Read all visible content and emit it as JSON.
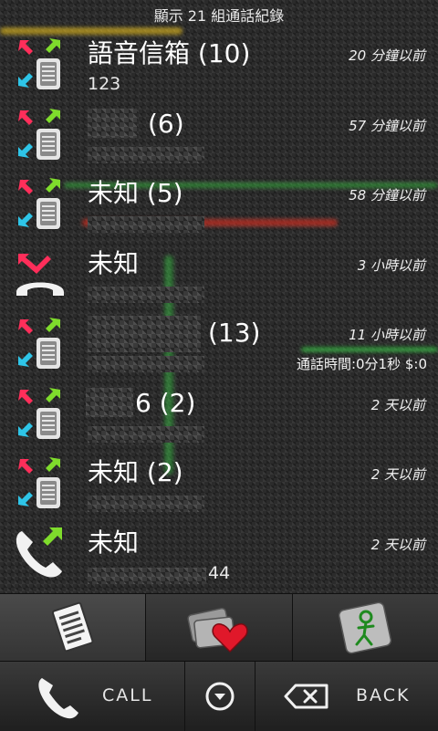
{
  "header": {
    "title": "顯示 21 組通話紀錄"
  },
  "calls": [
    {
      "name": "語音信箱 (10)",
      "number": "123",
      "time": "20 分鐘以前",
      "extra": "",
      "icon": "mixed-calls-icon"
    },
    {
      "name": "(6)",
      "number": "",
      "time": "57 分鐘以前",
      "extra": "",
      "icon": "mixed-calls-icon"
    },
    {
      "name": "未知 (5)",
      "number": "",
      "time": "58 分鐘以前",
      "extra": "",
      "icon": "mixed-calls-icon"
    },
    {
      "name": "未知",
      "number": "",
      "time": "3 小時以前",
      "extra": "",
      "icon": "missed-call-icon"
    },
    {
      "name": "(13)",
      "number": "",
      "time": "11 小時以前",
      "extra": "通話時間:0分1秒 $:0",
      "icon": "mixed-calls-icon"
    },
    {
      "name": "6 (2)",
      "number": "",
      "time": "2 天以前",
      "extra": "",
      "icon": "mixed-calls-icon"
    },
    {
      "name": "未知 (2)",
      "number": "",
      "time": "2 天以前",
      "extra": "",
      "icon": "mixed-calls-icon"
    },
    {
      "name": "未知",
      "number": "44",
      "time": "2 天以前",
      "extra": "",
      "icon": "outgoing-call-icon"
    }
  ],
  "tabs": [
    {
      "name": "call-log-tab",
      "icon": "document-icon",
      "active": true
    },
    {
      "name": "favorites-tab",
      "icon": "heart-contacts-icon",
      "active": false
    },
    {
      "name": "contacts-tab",
      "icon": "person-icon",
      "active": false
    }
  ],
  "bottom_bar": {
    "call_label": "CALL",
    "back_label": "BACK",
    "menu_icon": "chevron-down-circle-icon",
    "delete_icon": "backspace-icon"
  },
  "colors": {
    "outgoing_arrow": "#7fdc2c",
    "incoming_arrow": "#2ec5e8",
    "missed_arrow": "#ff2e5a",
    "glow_yellow": "#ffd21f",
    "glow_green": "#3de14a",
    "glow_red": "#ff3322"
  }
}
